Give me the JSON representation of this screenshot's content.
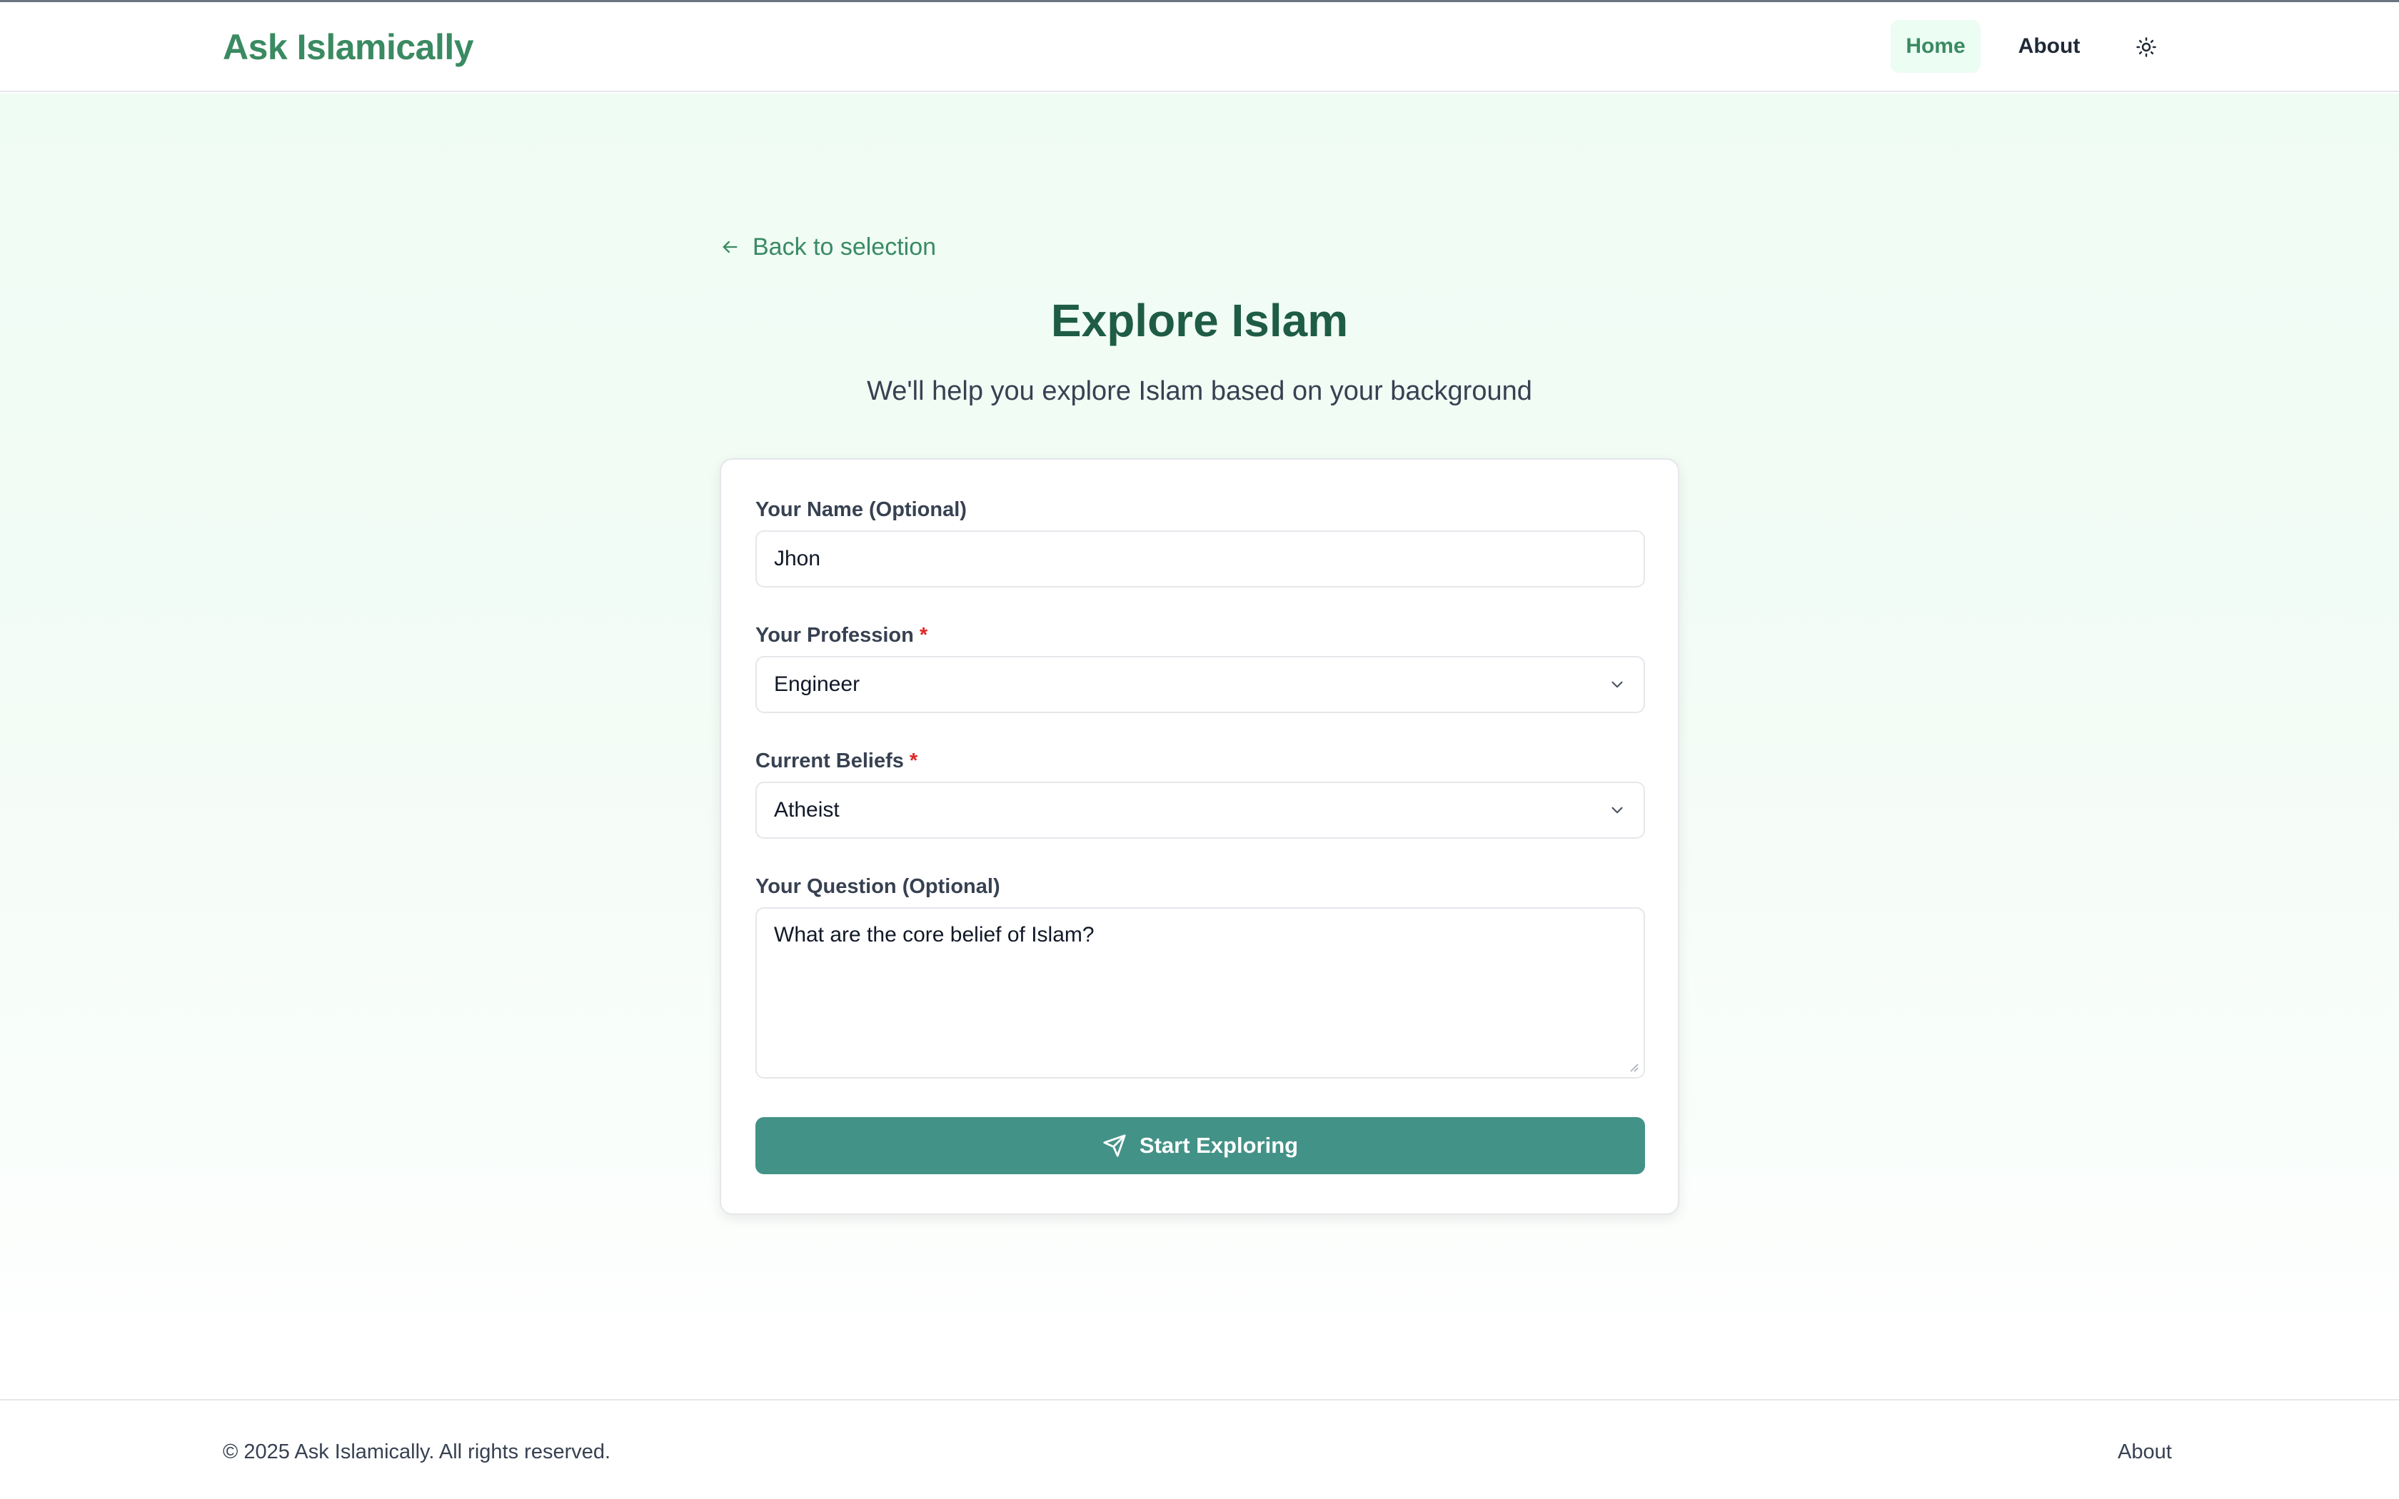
{
  "header": {
    "brand": "Ask Islamically",
    "nav": [
      {
        "label": "Home",
        "active": true
      },
      {
        "label": "About",
        "active": false
      }
    ],
    "theme_icon": "sun-icon"
  },
  "colors": {
    "brand_green": "#3a8a62",
    "title_green": "#1f5c45",
    "button_teal": "#439287",
    "required_red": "#dc2626",
    "active_nav_bg": "#ecfdf3"
  },
  "main": {
    "back_link": "Back to selection",
    "title": "Explore Islam",
    "subtitle": "We'll help you explore Islam based on your background"
  },
  "form": {
    "name": {
      "label": "Your Name (Optional)",
      "value": "Jhon"
    },
    "profession": {
      "label": "Your Profession",
      "required_mark": "*",
      "value": "Engineer"
    },
    "beliefs": {
      "label": "Current Beliefs",
      "required_mark": "*",
      "value": "Atheist"
    },
    "question": {
      "label": "Your Question (Optional)",
      "value": "What are the core belief of Islam?"
    },
    "submit_label": "Start Exploring",
    "submit_icon": "send-icon"
  },
  "footer": {
    "copyright": "© 2025 Ask Islamically. All rights reserved.",
    "about": "About"
  }
}
